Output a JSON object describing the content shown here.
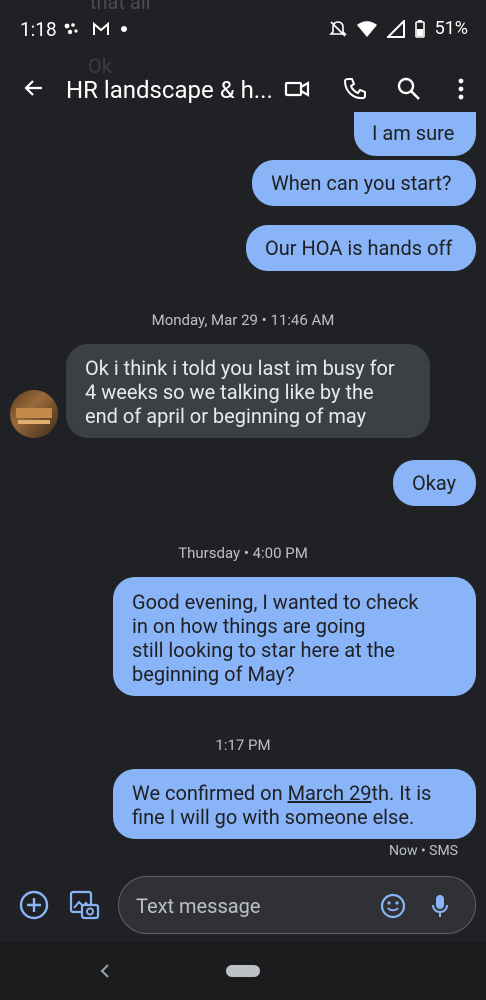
{
  "status_bar": {
    "time": "1:18",
    "battery": "51%"
  },
  "header": {
    "title": "HR landscape & h..."
  },
  "ghost_text": {
    "top": "that all",
    "second": "Ok"
  },
  "messages": [
    {
      "type": "out",
      "text": "I am sure"
    },
    {
      "type": "out",
      "text": "When can you start?"
    },
    {
      "type": "out",
      "text": "Our HOA is hands off"
    },
    {
      "type": "timestamp",
      "text": "Monday, Mar 29 • 11:46 AM"
    },
    {
      "type": "in",
      "text": "Ok i think i told you last im busy for\n4 weeks so we talking like by the\nend of april or beginning of may"
    },
    {
      "type": "out",
      "text": "Okay"
    },
    {
      "type": "timestamp",
      "text": "Thursday • 4:00 PM"
    },
    {
      "type": "out",
      "text": "Good evening, I wanted to check\nin on how things are going\nstill looking to star here at the\nbeginning of May?"
    },
    {
      "type": "timestamp",
      "text": "1:17 PM"
    },
    {
      "type": "out_link",
      "pre": "We confirmed on ",
      "link": "March 29",
      "post": "th. It is\nfine I will go with someone else."
    }
  ],
  "message_status": "Now • SMS",
  "compose": {
    "placeholder": "Text message"
  },
  "colors": {
    "outgoing_bubble": "#8ab4f8",
    "incoming_bubble": "#3c4043",
    "background": "#202124",
    "accent": "#8ab4f8"
  },
  "icons": [
    "back-arrow-icon",
    "video-call-icon",
    "phone-icon",
    "search-icon",
    "more-vert-icon",
    "add-icon",
    "gallery-icon",
    "emoji-icon",
    "mic-icon",
    "nav-back-icon"
  ]
}
